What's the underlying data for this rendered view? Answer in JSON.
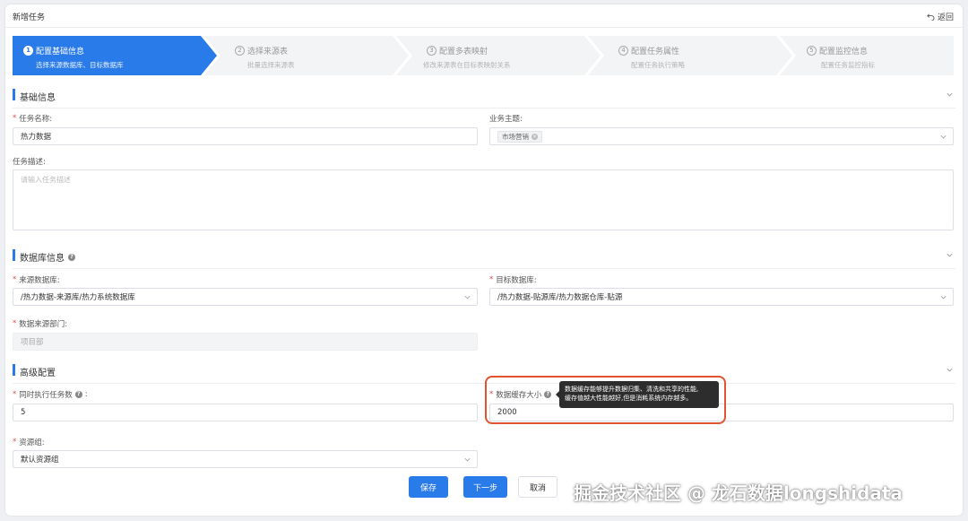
{
  "header": {
    "title": "新增任务",
    "back_label": "返回"
  },
  "steps": [
    {
      "num": "1",
      "title": "配置基础信息",
      "sub": "选择来源数据库、目标数据库"
    },
    {
      "num": "2",
      "title": "选择来源表",
      "sub": "批量选择来源表"
    },
    {
      "num": "3",
      "title": "配置多表映射",
      "sub": "修改来源表在目标表映射关系"
    },
    {
      "num": "4",
      "title": "配置任务属性",
      "sub": "配置任务执行策略"
    },
    {
      "num": "5",
      "title": "配置监控信息",
      "sub": "配置任务监控指标"
    }
  ],
  "basic": {
    "section_title": "基础信息",
    "task_name_label": "任务名称:",
    "task_name_value": "热力数据",
    "business_label": "业务主题:",
    "business_tag": "市场营销",
    "desc_label": "任务描述:",
    "desc_placeholder": "请输入任务描述"
  },
  "db": {
    "section_title": "数据库信息",
    "source_label": "来源数据库:",
    "source_value": "/热力数据-来源库/热力系统数据库",
    "target_label": "目标数据库:",
    "target_value": "/热力数据-贴源库/热力数据仓库-贴源",
    "dept_label": "数据来源部门:",
    "dept_value": "项目部"
  },
  "advanced": {
    "section_title": "高级配置",
    "concurrent_label": "同时执行任务数",
    "concurrent_colon": ":",
    "concurrent_value": "5",
    "cache_label": "数据缓存大小",
    "cache_value": "2000",
    "tooltip_line1": "数据缓存能够提升数据归集、清洗和共享的性能,",
    "tooltip_line2": "缓存值越大性能越好,但是消耗系统内存越多。",
    "resource_label": "资源组:",
    "resource_value": "默认资源组"
  },
  "buttons": {
    "save": "保存",
    "next": "下一步",
    "cancel": "取消"
  },
  "watermark": "掘金技术社区 @ 龙石数据longshidata",
  "colors": {
    "primary": "#2a7bea",
    "highlight": "#e0552f",
    "required": "#e34d4d"
  }
}
